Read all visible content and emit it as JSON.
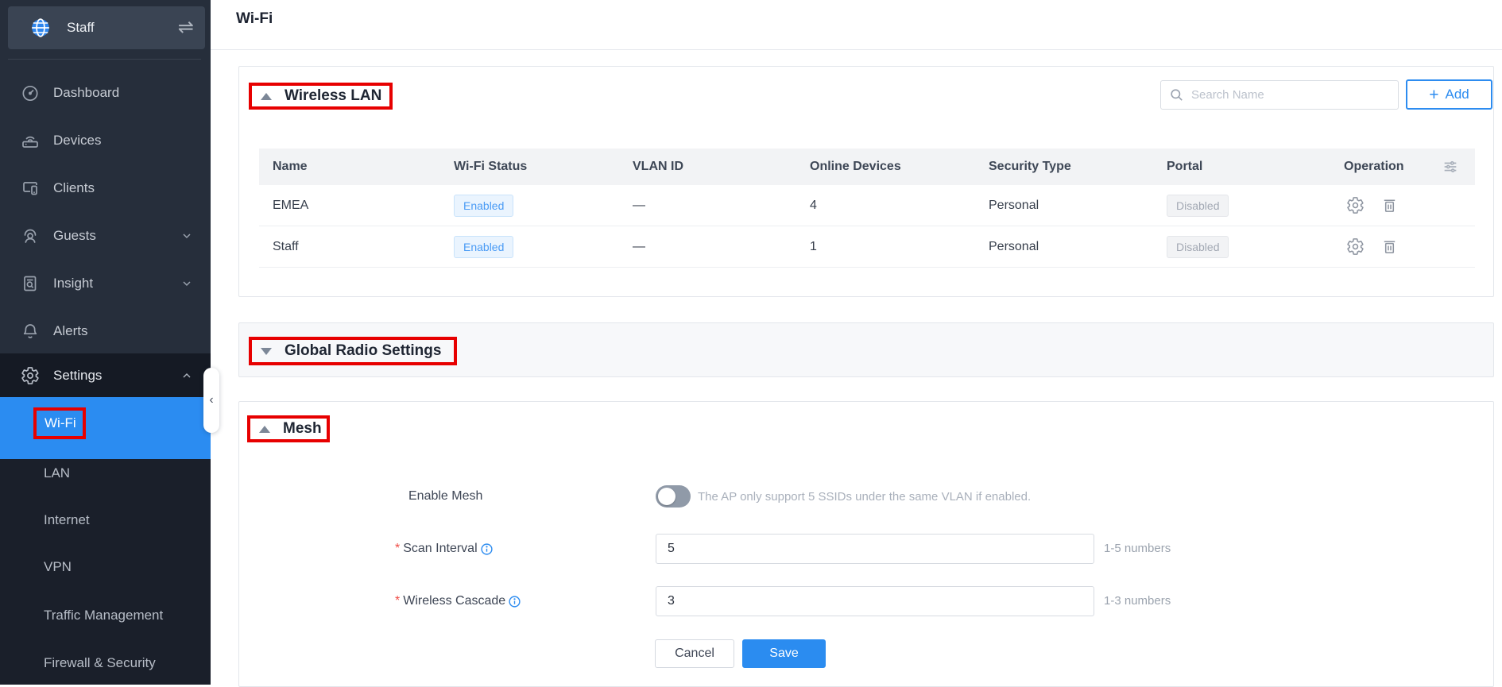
{
  "colors": {
    "accent": "#2d8cf0",
    "annotation_red": "#e70000",
    "sidebar_bg": "#262e3b",
    "active_item_bg": "#2b8cf1"
  },
  "sidebar": {
    "site": {
      "name": "Staff",
      "swap_glyph": "⇌"
    },
    "items": [
      {
        "label": "Dashboard"
      },
      {
        "label": "Devices"
      },
      {
        "label": "Clients"
      },
      {
        "label": "Guests"
      },
      {
        "label": "Insight"
      },
      {
        "label": "Alerts"
      }
    ],
    "settings": {
      "label": "Settings"
    },
    "submenu": {
      "active": "Wi-Fi",
      "items": [
        "LAN",
        "Internet",
        "VPN",
        "Traffic Management",
        "Firewall & Security"
      ]
    },
    "collapse_glyph": "‹"
  },
  "page": {
    "title": "Wi-Fi"
  },
  "wireless_lan": {
    "title": "Wireless LAN",
    "search_placeholder": "Search Name",
    "add_plus": "+",
    "add_label": "Add",
    "columns": [
      "Name",
      "Wi-Fi Status",
      "VLAN ID",
      "Online Devices",
      "Security Type",
      "Portal",
      "Operation"
    ],
    "rows": [
      {
        "name": "EMEA",
        "wifi_status": "Enabled",
        "vlan_id": "—",
        "online_devices": "4",
        "security_type": "Personal",
        "portal": "Disabled"
      },
      {
        "name": "Staff",
        "wifi_status": "Enabled",
        "vlan_id": "—",
        "online_devices": "1",
        "security_type": "Personal",
        "portal": "Disabled"
      }
    ]
  },
  "global_radio_settings": {
    "title": "Global Radio Settings"
  },
  "mesh": {
    "title": "Mesh",
    "enable": {
      "label": "Enable Mesh",
      "state": "off",
      "hint": "The AP only support 5 SSIDs under the same VLAN if enabled."
    },
    "fields": [
      {
        "required": "*",
        "label": "Scan Interval",
        "value": "5",
        "hint": "1-5 numbers"
      },
      {
        "required": "*",
        "label": "Wireless Cascade",
        "value": "3",
        "hint": "1-3 numbers"
      }
    ],
    "buttons": {
      "cancel": "Cancel",
      "save": "Save"
    }
  }
}
